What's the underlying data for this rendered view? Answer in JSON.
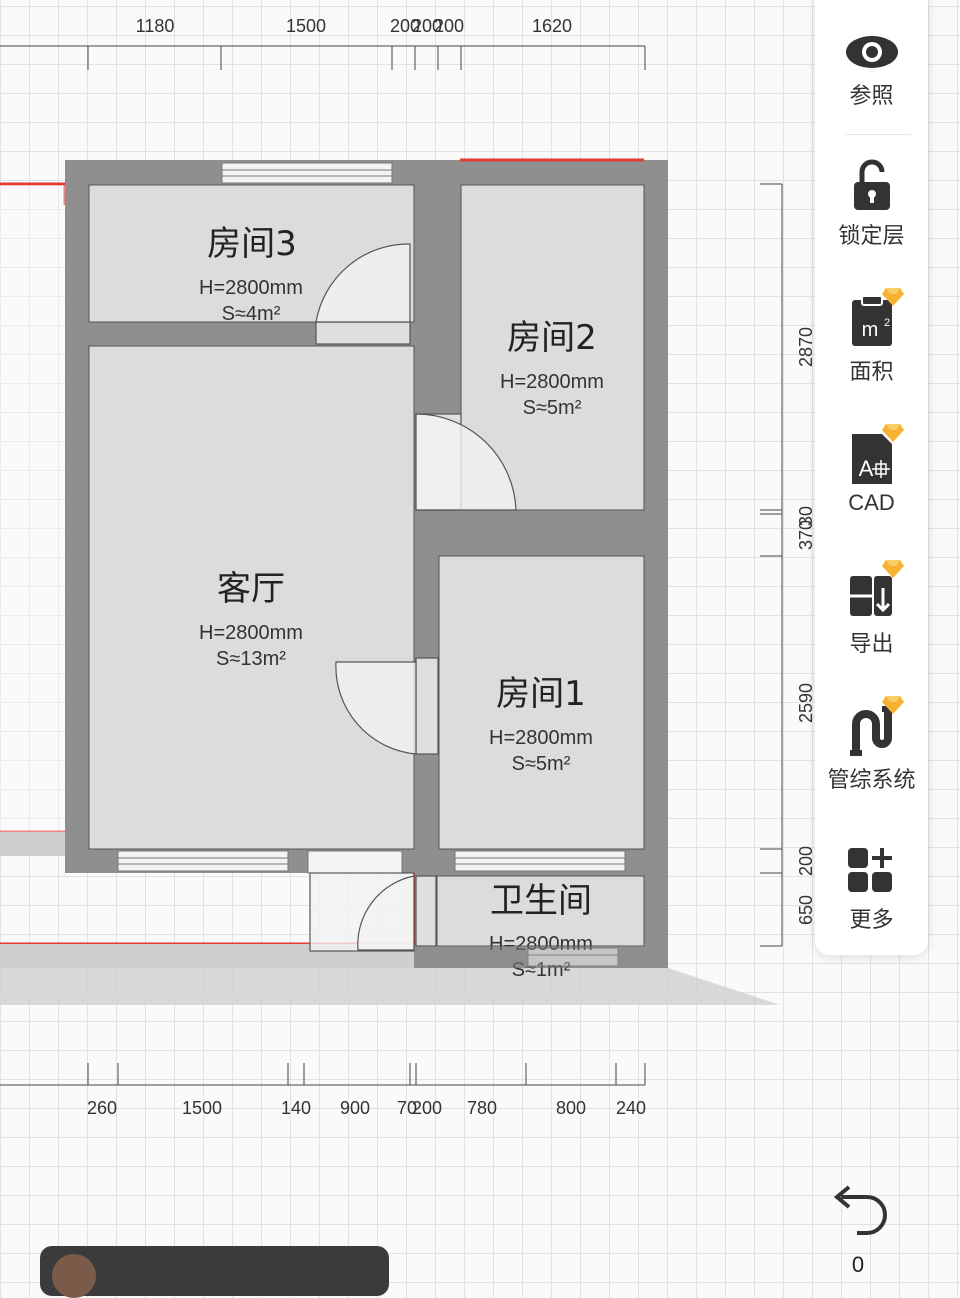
{
  "dimensions": {
    "top": [
      "1180",
      "1500",
      "200",
      "200",
      "200",
      "1620"
    ],
    "bottom": [
      "260",
      "1500",
      "140",
      "900",
      "70",
      "200",
      "780",
      "800",
      "240"
    ],
    "right": [
      "2870",
      "30",
      "370",
      "2590",
      "200",
      "650"
    ]
  },
  "rooms": [
    {
      "name": "房间3",
      "height": "H=2800mm",
      "area": "S≈4m²"
    },
    {
      "name": "房间2",
      "height": "H=2800mm",
      "area": "S≈5m²"
    },
    {
      "name": "客厅",
      "height": "H=2800mm",
      "area": "S≈13m²"
    },
    {
      "name": "房间1",
      "height": "H=2800mm",
      "area": "S≈5m²"
    },
    {
      "name": "卫生间",
      "height": "H=2800mm",
      "area": "S≈1m²"
    }
  ],
  "toolbar": {
    "reference": {
      "label": "参照",
      "icon": "eye-icon"
    },
    "lock_layer": {
      "label": "锁定层",
      "icon": "unlock-icon"
    },
    "area": {
      "label": "面积",
      "icon": "area-clipboard-icon",
      "premium": true
    },
    "cad": {
      "label": "CAD",
      "icon": "cad-file-icon",
      "premium": true
    },
    "export": {
      "label": "导出",
      "icon": "export-icon",
      "premium": true
    },
    "pipes": {
      "label": "管综系统",
      "icon": "pipe-icon",
      "premium": true
    },
    "more": {
      "label": "更多",
      "icon": "grid-plus-icon"
    }
  },
  "undo": {
    "count": "0",
    "icon": "undo-icon"
  },
  "colors": {
    "wall": "#8f8f8f",
    "floor": "#dcdcdc",
    "highlight": "#e53935",
    "premium": "#f5b233"
  }
}
